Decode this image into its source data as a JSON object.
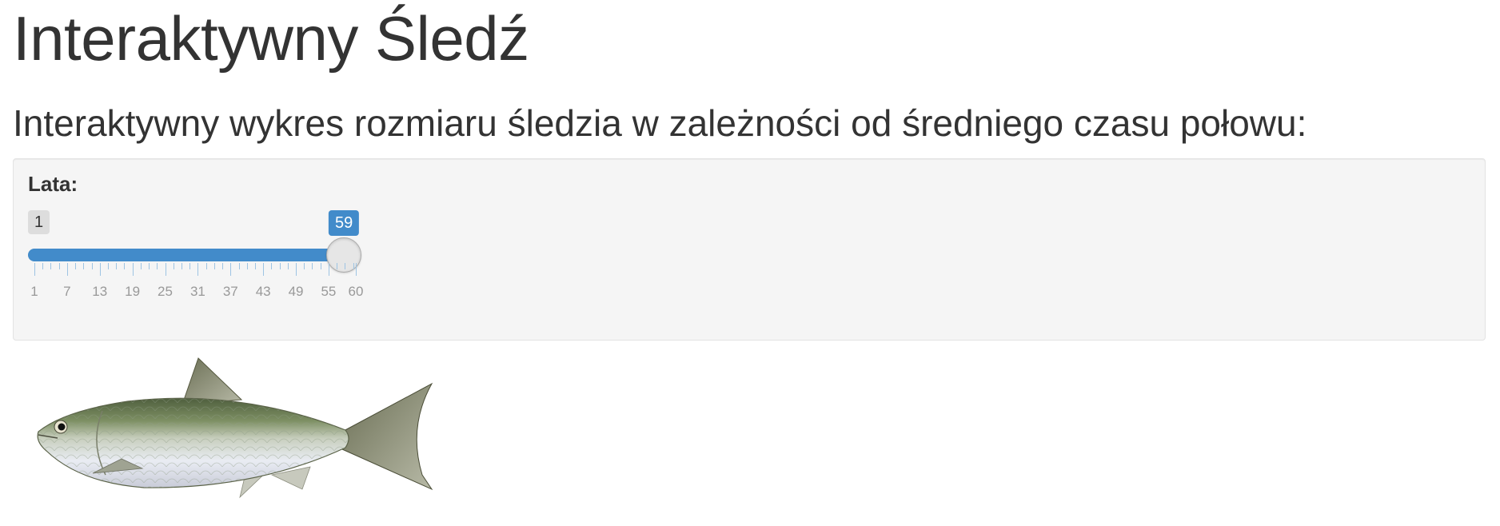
{
  "page": {
    "title": "Interaktywny Śledź",
    "subtitle": "Interaktywny wykres rozmiaru śledzia w zależności od średniego czasu połowu:"
  },
  "slider": {
    "label": "Lata:",
    "min": 1,
    "max": 60,
    "value": 59,
    "min_label": "1",
    "value_label": "59",
    "tick_labels": [
      "1",
      "7",
      "13",
      "19",
      "25",
      "31",
      "37",
      "43",
      "49",
      "55",
      "60"
    ],
    "accent_color": "#428bca"
  },
  "image": {
    "icon": "herring-fish-icon"
  }
}
